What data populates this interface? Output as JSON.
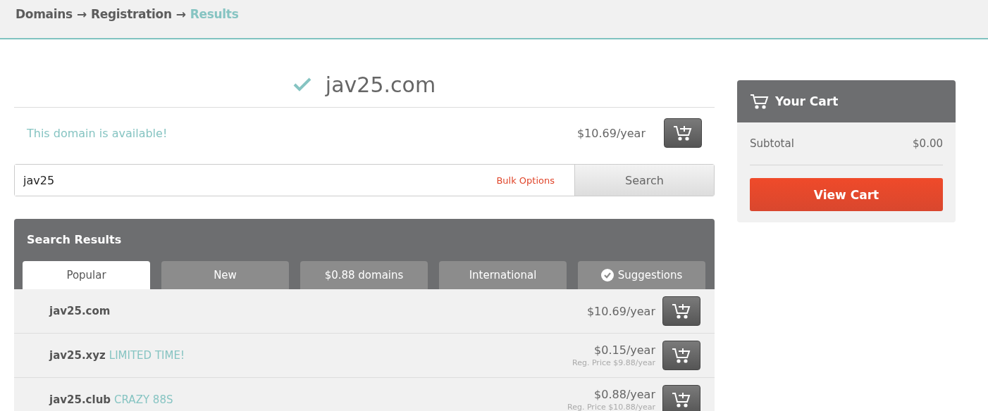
{
  "breadcrumb": [
    {
      "kind": "link",
      "label": "Domains"
    },
    {
      "kind": "arrow",
      "label": "→"
    },
    {
      "kind": "link",
      "label": "Registration"
    },
    {
      "kind": "arrow",
      "label": "→"
    },
    {
      "kind": "current",
      "label": "Results"
    }
  ],
  "domain": {
    "name": "jav25.com",
    "status": "This domain is available!",
    "price": "$10.69/year"
  },
  "search": {
    "value": "jav25",
    "bulk_options": "Bulk Options",
    "button": "Search"
  },
  "results": {
    "title": "Search Results",
    "tabs": [
      {
        "label": "Popular",
        "selected": true,
        "kind": "plain"
      },
      {
        "label": "New",
        "selected": false,
        "kind": "plain"
      },
      {
        "label": "$0.88 domains",
        "selected": false,
        "kind": "plain"
      },
      {
        "label": "International",
        "selected": false,
        "kind": "plain"
      },
      {
        "label": "Suggestions",
        "selected": false,
        "kind": "checked"
      }
    ],
    "rows": [
      {
        "domain": "jav25.com",
        "price": "$10.69/year"
      },
      {
        "domain": "jav25.xyz",
        "promo": "LIMITED TIME!",
        "price": "$0.15/year",
        "reg_price": "Reg. Price $9.88/year"
      },
      {
        "domain": "jav25.club",
        "promo": "CRAZY 88S",
        "price": "$0.88/year",
        "reg_price": "Reg. Price $10.88/year"
      }
    ]
  },
  "cart": {
    "title": "Your Cart",
    "subtotal_label": "Subtotal",
    "subtotal": "$0.00",
    "button": "View Cart"
  }
}
